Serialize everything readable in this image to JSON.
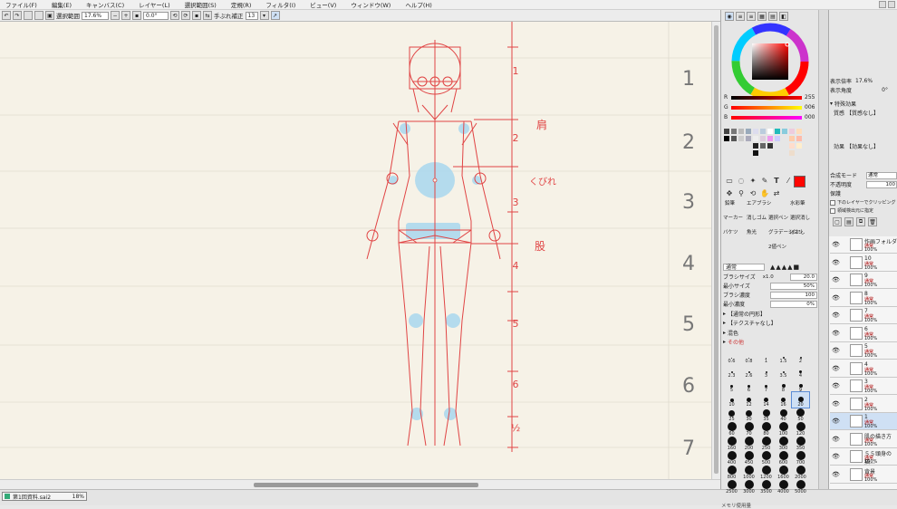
{
  "menu": [
    "ファイル(F)",
    "編集(E)",
    "キャンバス(C)",
    "レイヤー(L)",
    "選択範囲(S)",
    "定規(R)",
    "フィルタ(I)",
    "ビュー(V)",
    "ウィンドウ(W)",
    "ヘルプ(H)"
  ],
  "toolbar": {
    "selection_label": "選択範囲",
    "zoom_value": "17.6%",
    "rotation_value": "0.0°",
    "stabilizer_label": "手ぶれ補正",
    "stabilizer_value": "13"
  },
  "canvas": {
    "ruler_numbers": [
      "1",
      "2",
      "3",
      "4",
      "5",
      "6",
      "½"
    ],
    "annotations": [
      "肩",
      "くびれ",
      "股"
    ],
    "margin_numbers": [
      "1",
      "2",
      "3",
      "4",
      "5",
      "6",
      "7"
    ]
  },
  "status": {
    "doc_tab_name": "第1回資料.sai2",
    "doc_tab_zoom": "18%",
    "memory_text": "メモリ使用量"
  },
  "colors": {
    "accent_red": "#e8352a",
    "sketch_red": "#e04444",
    "sketch_blue": "#a9d8ef",
    "paper": "#f6f2e7"
  },
  "color_panel": {
    "r_label": "R",
    "r_value": "255",
    "g_label": "G",
    "g_value": "006",
    "b_label": "B",
    "b_value": "000",
    "tools": [
      "鉛筆",
      "エアブラシ",
      "水彩筆",
      "マーカー",
      "消しゴム",
      "選択ペン",
      "選択消し",
      "バケツ",
      "魚光",
      "グラデーション",
      "ぼかし",
      "2値ペン"
    ],
    "blend_mode": "通常",
    "brush_size_label": "ブラシサイズ",
    "brush_size_mult": "x1.0",
    "brush_size_value": "20.0",
    "min_size_label": "最小サイズ",
    "min_size_value": "50%",
    "density_label": "ブラシ濃度",
    "density_value": "100",
    "min_density_label": "最小濃度",
    "min_density_value": "0%",
    "shape_label": "【通常の円形】",
    "texture_label": "【テクスチャなし】",
    "mix_label": "混色",
    "other_label": "その他",
    "brush_sizes": [
      "0.6",
      "0.8",
      "1",
      "1.5",
      "2",
      "2.3",
      "2.6",
      "3",
      "3.5",
      "4",
      "5",
      "6",
      "7",
      "8",
      "9",
      "10",
      "12",
      "14",
      "16",
      "20",
      "25",
      "30",
      "35",
      "40",
      "50",
      "60",
      "70",
      "80",
      "100",
      "120",
      "160",
      "200",
      "250",
      "300",
      "350",
      "400",
      "450",
      "500",
      "600",
      "700",
      "800",
      "1000",
      "1200",
      "1600",
      "2000",
      "2500",
      "3000",
      "3500",
      "4000",
      "5000"
    ]
  },
  "layer_panel": {
    "display_zoom_label": "表示倍率",
    "display_zoom_value": "17.6%",
    "display_angle_label": "表示角度",
    "display_angle_value": "0°",
    "effect_header": "特殊効果",
    "texture_label": "質感",
    "texture_value": "【質感なし】",
    "effect_label": "効果",
    "effect_value": "【効果なし】",
    "blend_label": "合成モード",
    "blend_value": "通常",
    "opacity_label": "不透明度",
    "opacity_value": "100",
    "protect_label": "保護",
    "clip_label": "下のレイヤーでクリッピング",
    "source_label": "領域検出元に指定",
    "layers": [
      {
        "name": "作画フォルダ",
        "mode": "通常",
        "opacity": "100%"
      },
      {
        "name": "10",
        "mode": "通常",
        "opacity": "100%"
      },
      {
        "name": "9",
        "mode": "通常",
        "opacity": "100%"
      },
      {
        "name": "8",
        "mode": "通常",
        "opacity": "100%"
      },
      {
        "name": "7",
        "mode": "通常",
        "opacity": "100%"
      },
      {
        "name": "6",
        "mode": "通常",
        "opacity": "100%"
      },
      {
        "name": "5",
        "mode": "通常",
        "opacity": "100%"
      },
      {
        "name": "4",
        "mode": "通常",
        "opacity": "100%"
      },
      {
        "name": "3",
        "mode": "通常",
        "opacity": "100%"
      },
      {
        "name": "2",
        "mode": "通常",
        "opacity": "100%"
      },
      {
        "name": "1",
        "mode": "通常",
        "opacity": "100%"
      },
      {
        "name": "肌の描き方",
        "mode": "通常",
        "opacity": "100%"
      },
      {
        "name": "５５頭身の描...",
        "mode": "通常",
        "opacity": "100%"
      },
      {
        "name": "背景",
        "mode": "通常",
        "opacity": "100%"
      }
    ]
  }
}
